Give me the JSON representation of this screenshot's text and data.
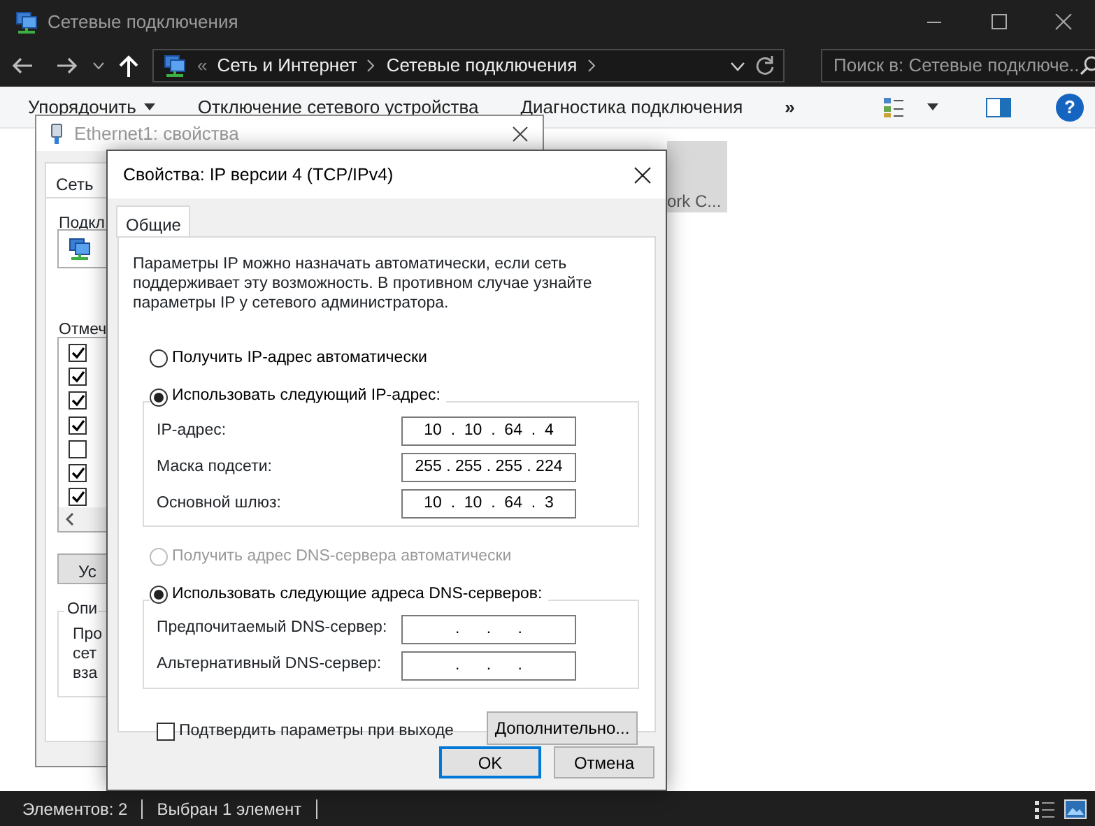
{
  "explorer": {
    "title": "Сетевые подключения",
    "address": {
      "overflow": "«",
      "crumbs": [
        "Сеть и Интернет",
        "Сетевые подключения"
      ]
    },
    "search": {
      "placeholder": "Поиск в: Сетевые подключе..."
    },
    "commands": [
      "Упорядочить",
      "Отключение сетевого устройства",
      "Диагностика подключения"
    ],
    "more": "»",
    "help": "?",
    "tile": {
      "label": "ork C...",
      "selected": true
    },
    "status": [
      "Элементов: 2",
      "Выбран 1 элемент"
    ]
  },
  "ethernet_dialog": {
    "title": "Ethernet1: свойства",
    "active": false,
    "tab": "Сеть",
    "connect_label": "Подкл",
    "components_label": "Отмеч",
    "components": [
      {
        "checked": true
      },
      {
        "checked": true
      },
      {
        "checked": true
      },
      {
        "checked": true
      },
      {
        "checked": false
      },
      {
        "checked": true
      },
      {
        "checked": true
      }
    ],
    "button": "Ус",
    "description": {
      "legend": "Опи",
      "lines": [
        "Про",
        "сет",
        "вза"
      ]
    }
  },
  "ipv4_dialog": {
    "title": "Свойства: IP версии 4 (TCP/IPv4)",
    "active": true,
    "tabs": [
      {
        "label": "Общие",
        "selected": true
      }
    ],
    "intro": "Параметры IP можно назначать автоматически, если сеть поддерживает эту возможность. В противном случае узнайте параметры IP у сетевого администратора.",
    "ip_auto": {
      "label": "Получить IP-адрес автоматически",
      "selected": false,
      "disabled": false
    },
    "ip_manual": {
      "label": "Использовать следующий IP-адрес:",
      "selected": true,
      "disabled": false,
      "fields": [
        {
          "label": "IP-адрес:",
          "value": "10  .  10  .  64  .  4"
        },
        {
          "label": "Маска подсети:",
          "value": "255 . 255 . 255 . 224"
        },
        {
          "label": "Основной шлюз:",
          "value": "10  .  10  .  64  .  3"
        }
      ]
    },
    "dns_auto": {
      "label": "Получить адрес DNS-сервера автоматически",
      "selected": false,
      "disabled": true
    },
    "dns_manual": {
      "label": "Использовать следующие адреса DNS-серверов:",
      "selected": true,
      "disabled": false,
      "fields": [
        {
          "label": "Предпочитаемый DNS-сервер:",
          "value": "     .      .      .     "
        },
        {
          "label": "Альтернативный DNS-сервер:",
          "value": "     .      .      .     "
        }
      ]
    },
    "validate": {
      "label": "Подтвердить параметры при выходе",
      "checked": false
    },
    "advanced": "Дополнительно...",
    "buttons": [
      {
        "label": "OK",
        "default": true
      },
      {
        "label": "Отмена",
        "default": false
      }
    ]
  }
}
